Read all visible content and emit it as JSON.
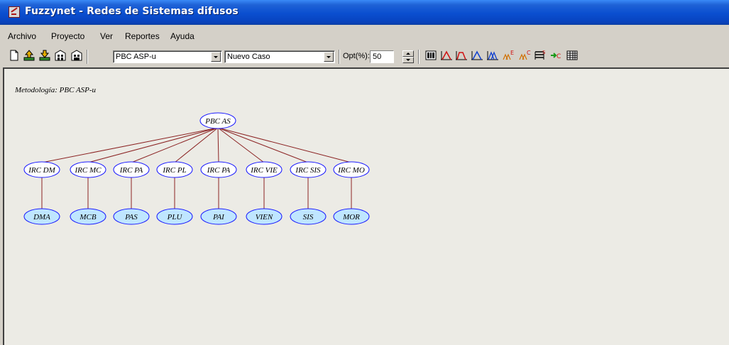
{
  "window": {
    "title": "Fuzzynet - Redes de Sistemas difusos"
  },
  "menu": {
    "items": [
      {
        "label": "Archivo"
      },
      {
        "label": "Proyecto"
      },
      {
        "label": "Ver"
      },
      {
        "label": "Reportes"
      },
      {
        "label": "Ayuda"
      }
    ]
  },
  "toolbar": {
    "methodology_value": "PBC ASP-u",
    "case_value": "Nuevo Caso",
    "opt_label": "Opt(%):",
    "opt_value": "50"
  },
  "canvas": {
    "caption": "Metodología: PBC ASP-u",
    "root": "PBC AS",
    "middle": [
      "IRC DM",
      "IRC MC",
      "IRC PA",
      "IRC PL",
      "IRC PA",
      "IRC VIE",
      "IRC SIS",
      "IRC MO"
    ],
    "leaves": [
      "DMA",
      "MCB",
      "PAS",
      "PLU",
      "PAI",
      "VIEN",
      "SIS",
      "MOR"
    ],
    "colors": {
      "edge": "#8b2323",
      "node_stroke": "#1a1aff",
      "root_fill": "#ffffff",
      "middle_fill": "#ffffff",
      "leaf_fill": "#bfe6ff"
    }
  }
}
